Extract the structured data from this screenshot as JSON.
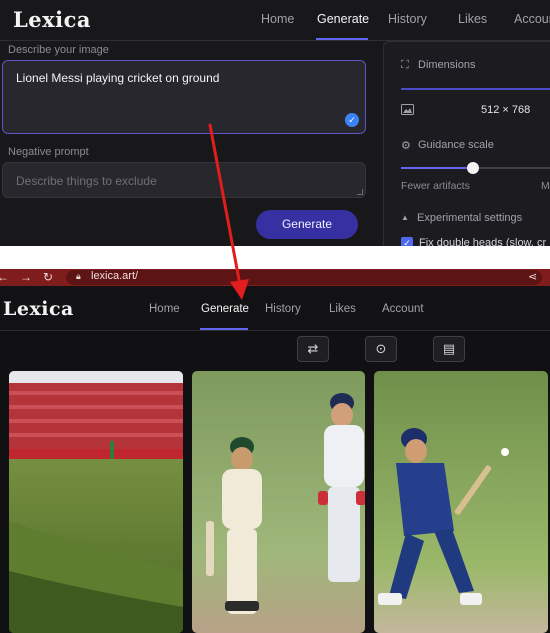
{
  "top": {
    "logo": "Lexica",
    "nav": [
      "Home",
      "Generate",
      "History",
      "Likes",
      "Accoun"
    ],
    "describe_label": "Describe your image",
    "prompt_value": "Lionel Messi playing cricket on ground",
    "negative_label": "Negative prompt",
    "negative_placeholder": "Describe things to exclude",
    "generate_label": "Generate",
    "side": {
      "dimensions_label": "Dimensions",
      "dimensions_value": "512 × 768",
      "guidance_label": "Guidance scale",
      "guidance_value": 0.5,
      "fewer_label": "Fewer artifacts",
      "more_label": "M",
      "experimental_label": "Experimental settings",
      "fix_heads_label": "Fix double heads (slow, cr"
    }
  },
  "bottom": {
    "url": "lexica.art/",
    "logo": "Lexica",
    "nav": [
      "Home",
      "Generate",
      "History",
      "Likes",
      "Account"
    ]
  },
  "colors": {
    "accent": "#6366f1",
    "arrow": "#e11d1d",
    "browser_bar": "#7f1d1d"
  }
}
